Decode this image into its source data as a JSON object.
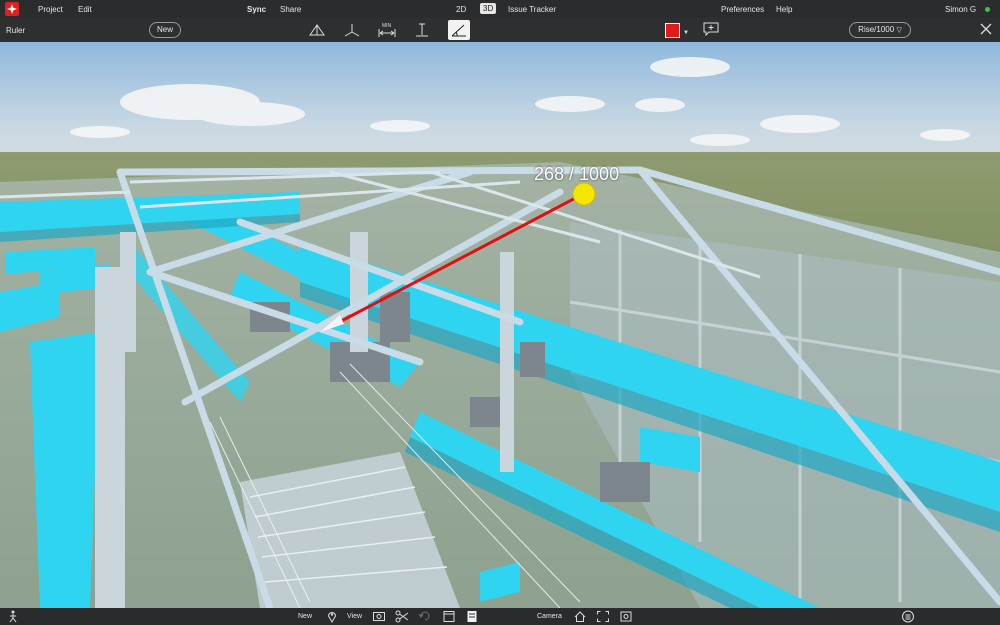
{
  "menu": {
    "project": "Project",
    "edit": "Edit",
    "sync": "Sync",
    "share": "Share",
    "view_2d": "2D",
    "view_3d": "3D",
    "issue_tracker": "Issue Tracker",
    "preferences": "Preferences",
    "help": "Help",
    "user": "Simon G"
  },
  "toolbar": {
    "mode": "Ruler",
    "new_label": "New",
    "color": "#e41b1b",
    "scale_select": "Rise/1000",
    "tools": [
      "elevation-icon",
      "plane-icon",
      "min-distance-icon",
      "vertical-distance-icon",
      "slope-icon"
    ]
  },
  "viewport": {
    "measurement_label": "268 / 1000"
  },
  "bottom": {
    "new": "New",
    "view": "View",
    "camera": "Camera"
  },
  "colors": {
    "accent_cyan": "#2fd4f0",
    "ruler_line": "#e01010",
    "ruler_end": "#f5e600",
    "status_online": "#35c83a"
  }
}
